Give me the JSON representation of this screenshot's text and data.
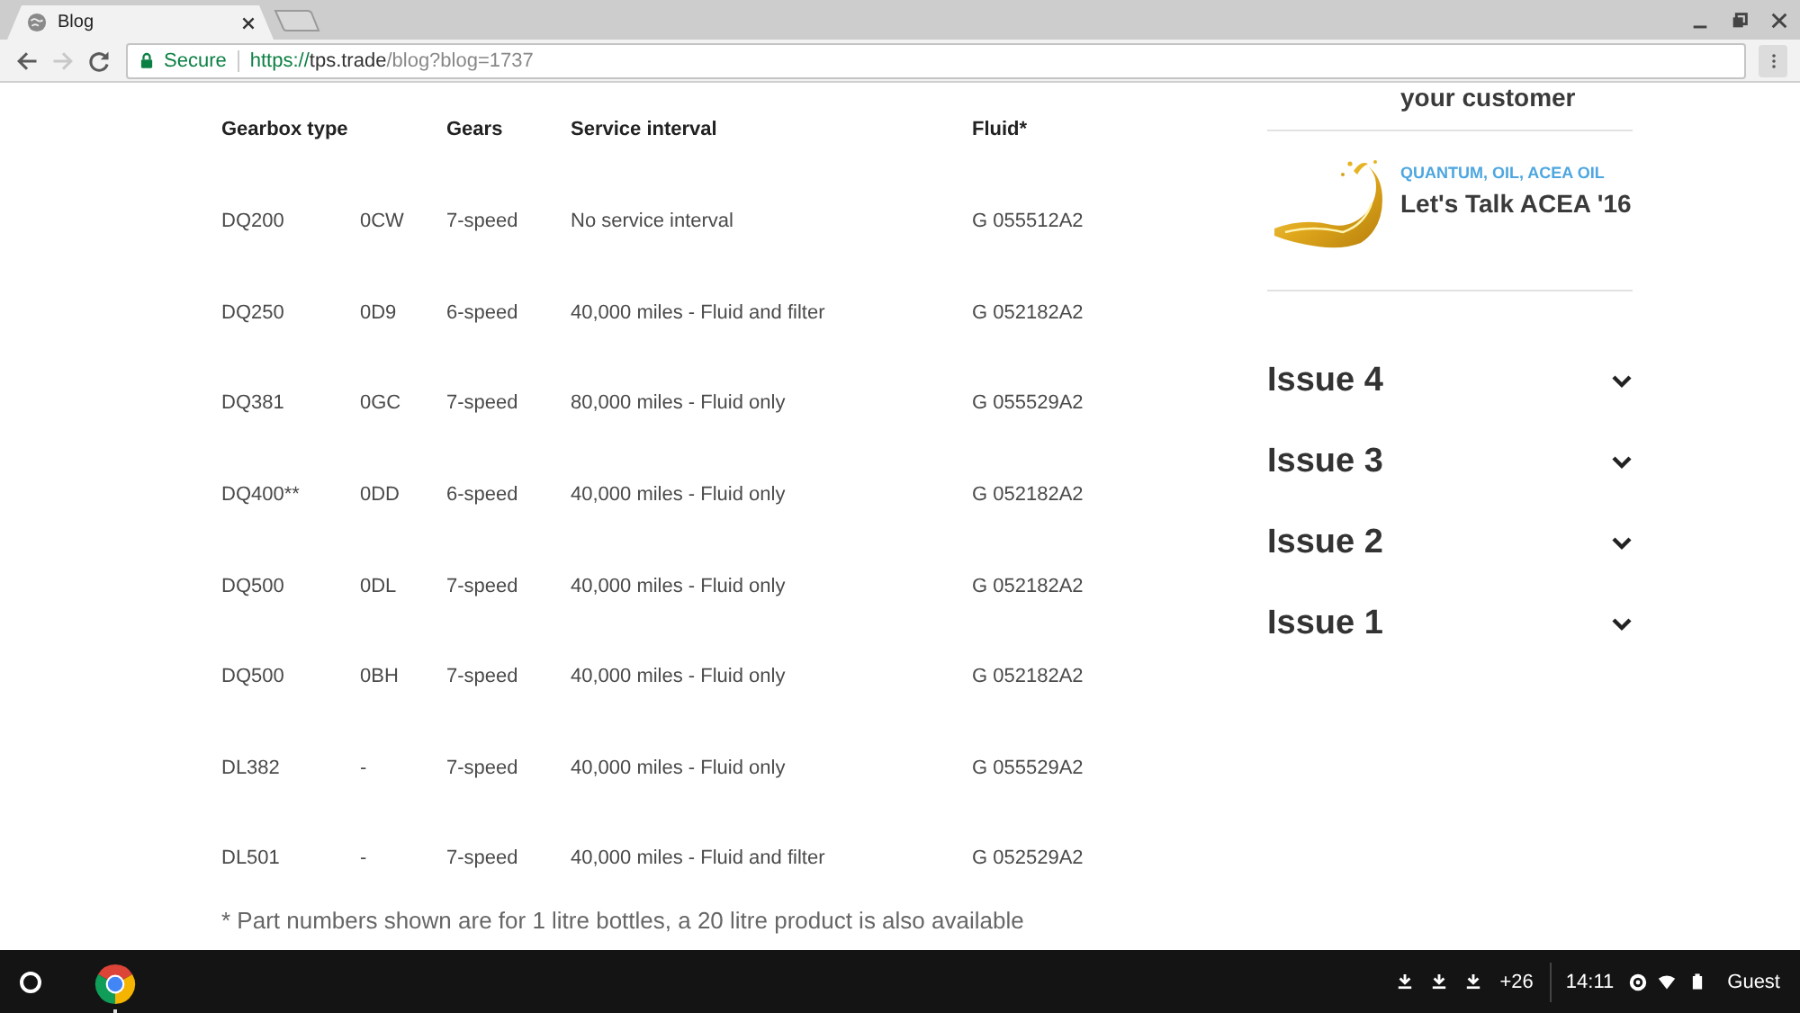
{
  "browser": {
    "tabs": [
      {
        "title": "Blog",
        "selected": true
      }
    ],
    "nav_buttons": [
      {
        "kind": "back",
        "disabled": false
      },
      {
        "kind": "forward",
        "disabled": true
      },
      {
        "kind": "reload",
        "disabled": false
      }
    ],
    "address_bar": {
      "security_label": "Secure",
      "url": {
        "scheme": "https://",
        "host": "tps.trade",
        "path": "/blog?blog=1737"
      }
    }
  },
  "page": {
    "table": {
      "headers": {
        "gearbox_type": "Gearbox type",
        "gears": "Gears",
        "service_interval": "Service interval",
        "fluid": "Fluid*"
      },
      "rows": [
        {
          "gearbox_type": "DQ200",
          "column_2": "0CW",
          "gears": "7-speed",
          "service_interval": "No service interval",
          "fluid": "G 055512A2"
        },
        {
          "gearbox_type": "DQ250",
          "column_2": "0D9",
          "gears": "6-speed",
          "service_interval": "40,000 miles - Fluid and filter",
          "fluid": "G 052182A2"
        },
        {
          "gearbox_type": "DQ381",
          "column_2": "0GC",
          "gears": "7-speed",
          "service_interval": "80,000 miles - Fluid only",
          "fluid": "G 055529A2"
        },
        {
          "gearbox_type": "DQ400**",
          "column_2": "0DD",
          "gears": "6-speed",
          "service_interval": "40,000 miles - Fluid only",
          "fluid": "G 052182A2"
        },
        {
          "gearbox_type": "DQ500",
          "column_2": "0DL",
          "gears": "7-speed",
          "service_interval": "40,000 miles - Fluid only",
          "fluid": "G 052182A2"
        },
        {
          "gearbox_type": "DQ500",
          "column_2": "0BH",
          "gears": "7-speed",
          "service_interval": "40,000 miles - Fluid only",
          "fluid": "G 052182A2"
        },
        {
          "gearbox_type": "DL382",
          "column_2": "-",
          "gears": "7-speed",
          "service_interval": "40,000 miles - Fluid only",
          "fluid": "G 055529A2"
        },
        {
          "gearbox_type": "DL501",
          "column_2": "-",
          "gears": "7-speed",
          "service_interval": "40,000 miles - Fluid and filter",
          "fluid": "G 052529A2"
        }
      ]
    },
    "footnote": "* Part numbers shown are for 1 litre bottles, a 20 litre product is also available"
  },
  "sidebar": {
    "posts": [
      {
        "title": "your customer",
        "has_thumbnail": false
      },
      {
        "tags": "QUANTUM, OIL, ACEA OIL",
        "title": "Let's Talk ACEA '16",
        "has_thumbnail": true
      }
    ],
    "issues": [
      {
        "label": "Issue 4",
        "expanded": false
      },
      {
        "label": "Issue 3",
        "expanded": false
      },
      {
        "label": "Issue 2",
        "expanded": false
      },
      {
        "label": "Issue 1",
        "expanded": false
      }
    ]
  },
  "shelf": {
    "pinned_apps": [
      {
        "kind": "browser",
        "running": true
      }
    ],
    "download_badge": "+26",
    "time": "14:11",
    "user": "Guest"
  }
}
